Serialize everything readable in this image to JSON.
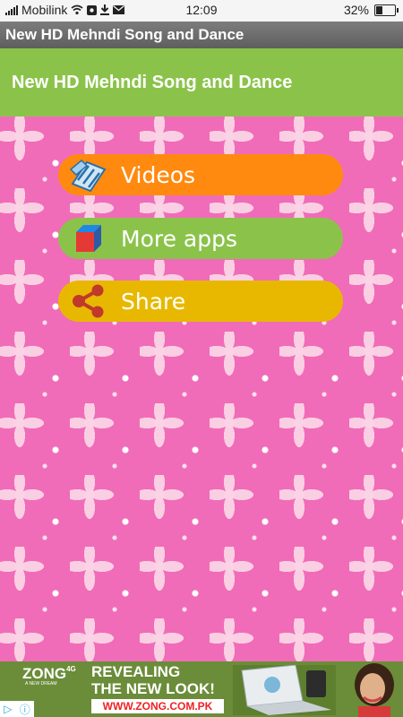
{
  "status_bar": {
    "carrier": "Mobilink",
    "time": "12:09",
    "battery_percent": "32%",
    "battery_level": 0.32
  },
  "window": {
    "title": "New HD Mehndi Song and Dance"
  },
  "action_bar": {
    "title": "New HD Mehndi Song and Dance",
    "color": "#8bc34a"
  },
  "menu": {
    "items": [
      {
        "label": "Videos",
        "icon": "film-strip-icon",
        "color": "#ff8a0f"
      },
      {
        "label": "More apps",
        "icon": "cube-icon",
        "color": "#8bc34a"
      },
      {
        "label": "Share",
        "icon": "share-icon",
        "color": "#e8b800"
      }
    ]
  },
  "ad": {
    "brand": "ZONG",
    "brand_suffix": "4G",
    "brand_tagline": "A NEW DREAM",
    "headline_line1": "REVEALING",
    "headline_line2": "THE NEW LOOK!",
    "url": "WWW.ZONG.COM.PK"
  }
}
